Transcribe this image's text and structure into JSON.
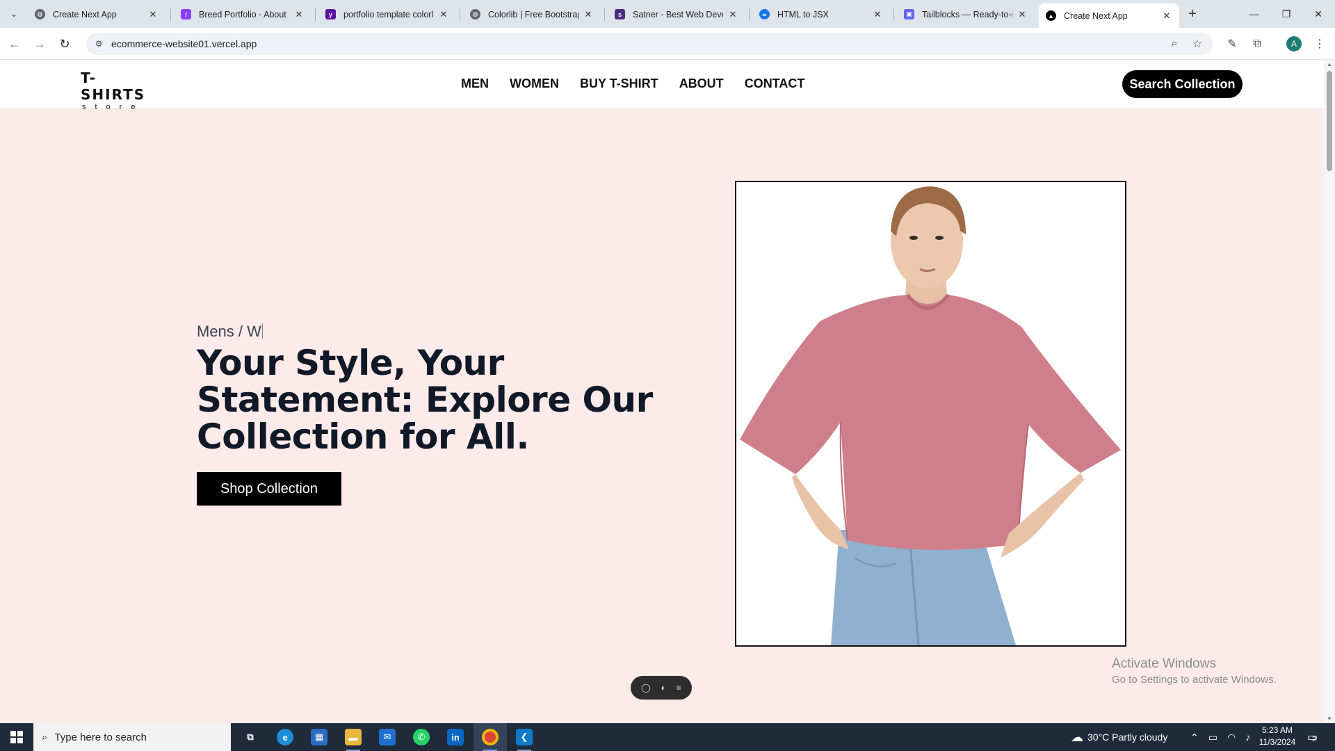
{
  "browser": {
    "tabs": [
      {
        "title": "Create Next App",
        "icon": "globe-icon",
        "active": false
      },
      {
        "title": "Breed Portfolio - About",
        "icon": "framer-icon",
        "active": false
      },
      {
        "title": "portfolio template colorlib",
        "icon": "yahoo-icon",
        "active": false
      },
      {
        "title": "Colorlib | Free Bootstrap W",
        "icon": "globe-icon",
        "active": false
      },
      {
        "title": "Satner - Best Web Develop",
        "icon": "satner-icon",
        "active": false
      },
      {
        "title": "HTML to JSX",
        "icon": "transform-icon",
        "active": false
      },
      {
        "title": "Tailblocks — Ready-to-use",
        "icon": "tailblocks-icon",
        "active": false
      },
      {
        "title": "Create Next App",
        "icon": "vercel-icon",
        "active": true
      }
    ],
    "url": "ecommerce-website01.vercel.app",
    "profile_initial": "A"
  },
  "site": {
    "logo_main": "T-SHIRTS",
    "logo_sub": "store",
    "nav": [
      "MEN",
      "WOMEN",
      "BUY T-SHIRT",
      "ABOUT",
      "CONTACT"
    ],
    "search_button": "Search Collection",
    "hero": {
      "kicker": "Mens / W",
      "title": "Your Style, Your Statement: Explore Our Collection for All.",
      "cta": "Shop Collection"
    }
  },
  "os": {
    "watermark_title": "Activate Windows",
    "watermark_sub": "Go to Settings to activate Windows.",
    "search_placeholder": "Type here to search",
    "weather": "30°C  Partly cloudy",
    "time": "5:23 AM",
    "date": "11/3/2024",
    "notification_count": "2"
  },
  "colors": {
    "page_bg": "#fcebea",
    "accent": "#000000",
    "shirt": "#cf7f89",
    "jeans": "#8fb1cf"
  }
}
